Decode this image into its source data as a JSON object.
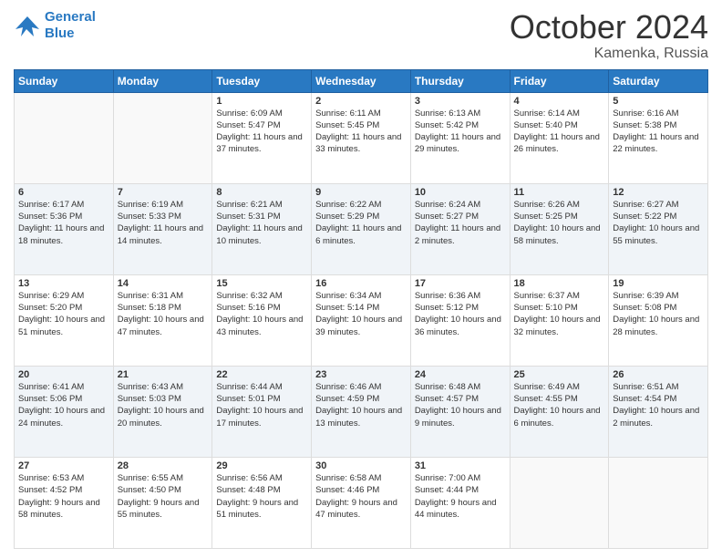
{
  "header": {
    "logo_line1": "General",
    "logo_line2": "Blue",
    "month": "October 2024",
    "location": "Kamenka, Russia"
  },
  "weekdays": [
    "Sunday",
    "Monday",
    "Tuesday",
    "Wednesday",
    "Thursday",
    "Friday",
    "Saturday"
  ],
  "weeks": [
    [
      {
        "day": "",
        "sunrise": "",
        "sunset": "",
        "daylight": ""
      },
      {
        "day": "",
        "sunrise": "",
        "sunset": "",
        "daylight": ""
      },
      {
        "day": "1",
        "sunrise": "Sunrise: 6:09 AM",
        "sunset": "Sunset: 5:47 PM",
        "daylight": "Daylight: 11 hours and 37 minutes."
      },
      {
        "day": "2",
        "sunrise": "Sunrise: 6:11 AM",
        "sunset": "Sunset: 5:45 PM",
        "daylight": "Daylight: 11 hours and 33 minutes."
      },
      {
        "day": "3",
        "sunrise": "Sunrise: 6:13 AM",
        "sunset": "Sunset: 5:42 PM",
        "daylight": "Daylight: 11 hours and 29 minutes."
      },
      {
        "day": "4",
        "sunrise": "Sunrise: 6:14 AM",
        "sunset": "Sunset: 5:40 PM",
        "daylight": "Daylight: 11 hours and 26 minutes."
      },
      {
        "day": "5",
        "sunrise": "Sunrise: 6:16 AM",
        "sunset": "Sunset: 5:38 PM",
        "daylight": "Daylight: 11 hours and 22 minutes."
      }
    ],
    [
      {
        "day": "6",
        "sunrise": "Sunrise: 6:17 AM",
        "sunset": "Sunset: 5:36 PM",
        "daylight": "Daylight: 11 hours and 18 minutes."
      },
      {
        "day": "7",
        "sunrise": "Sunrise: 6:19 AM",
        "sunset": "Sunset: 5:33 PM",
        "daylight": "Daylight: 11 hours and 14 minutes."
      },
      {
        "day": "8",
        "sunrise": "Sunrise: 6:21 AM",
        "sunset": "Sunset: 5:31 PM",
        "daylight": "Daylight: 11 hours and 10 minutes."
      },
      {
        "day": "9",
        "sunrise": "Sunrise: 6:22 AM",
        "sunset": "Sunset: 5:29 PM",
        "daylight": "Daylight: 11 hours and 6 minutes."
      },
      {
        "day": "10",
        "sunrise": "Sunrise: 6:24 AM",
        "sunset": "Sunset: 5:27 PM",
        "daylight": "Daylight: 11 hours and 2 minutes."
      },
      {
        "day": "11",
        "sunrise": "Sunrise: 6:26 AM",
        "sunset": "Sunset: 5:25 PM",
        "daylight": "Daylight: 10 hours and 58 minutes."
      },
      {
        "day": "12",
        "sunrise": "Sunrise: 6:27 AM",
        "sunset": "Sunset: 5:22 PM",
        "daylight": "Daylight: 10 hours and 55 minutes."
      }
    ],
    [
      {
        "day": "13",
        "sunrise": "Sunrise: 6:29 AM",
        "sunset": "Sunset: 5:20 PM",
        "daylight": "Daylight: 10 hours and 51 minutes."
      },
      {
        "day": "14",
        "sunrise": "Sunrise: 6:31 AM",
        "sunset": "Sunset: 5:18 PM",
        "daylight": "Daylight: 10 hours and 47 minutes."
      },
      {
        "day": "15",
        "sunrise": "Sunrise: 6:32 AM",
        "sunset": "Sunset: 5:16 PM",
        "daylight": "Daylight: 10 hours and 43 minutes."
      },
      {
        "day": "16",
        "sunrise": "Sunrise: 6:34 AM",
        "sunset": "Sunset: 5:14 PM",
        "daylight": "Daylight: 10 hours and 39 minutes."
      },
      {
        "day": "17",
        "sunrise": "Sunrise: 6:36 AM",
        "sunset": "Sunset: 5:12 PM",
        "daylight": "Daylight: 10 hours and 36 minutes."
      },
      {
        "day": "18",
        "sunrise": "Sunrise: 6:37 AM",
        "sunset": "Sunset: 5:10 PM",
        "daylight": "Daylight: 10 hours and 32 minutes."
      },
      {
        "day": "19",
        "sunrise": "Sunrise: 6:39 AM",
        "sunset": "Sunset: 5:08 PM",
        "daylight": "Daylight: 10 hours and 28 minutes."
      }
    ],
    [
      {
        "day": "20",
        "sunrise": "Sunrise: 6:41 AM",
        "sunset": "Sunset: 5:06 PM",
        "daylight": "Daylight: 10 hours and 24 minutes."
      },
      {
        "day": "21",
        "sunrise": "Sunrise: 6:43 AM",
        "sunset": "Sunset: 5:03 PM",
        "daylight": "Daylight: 10 hours and 20 minutes."
      },
      {
        "day": "22",
        "sunrise": "Sunrise: 6:44 AM",
        "sunset": "Sunset: 5:01 PM",
        "daylight": "Daylight: 10 hours and 17 minutes."
      },
      {
        "day": "23",
        "sunrise": "Sunrise: 6:46 AM",
        "sunset": "Sunset: 4:59 PM",
        "daylight": "Daylight: 10 hours and 13 minutes."
      },
      {
        "day": "24",
        "sunrise": "Sunrise: 6:48 AM",
        "sunset": "Sunset: 4:57 PM",
        "daylight": "Daylight: 10 hours and 9 minutes."
      },
      {
        "day": "25",
        "sunrise": "Sunrise: 6:49 AM",
        "sunset": "Sunset: 4:55 PM",
        "daylight": "Daylight: 10 hours and 6 minutes."
      },
      {
        "day": "26",
        "sunrise": "Sunrise: 6:51 AM",
        "sunset": "Sunset: 4:54 PM",
        "daylight": "Daylight: 10 hours and 2 minutes."
      }
    ],
    [
      {
        "day": "27",
        "sunrise": "Sunrise: 6:53 AM",
        "sunset": "Sunset: 4:52 PM",
        "daylight": "Daylight: 9 hours and 58 minutes."
      },
      {
        "day": "28",
        "sunrise": "Sunrise: 6:55 AM",
        "sunset": "Sunset: 4:50 PM",
        "daylight": "Daylight: 9 hours and 55 minutes."
      },
      {
        "day": "29",
        "sunrise": "Sunrise: 6:56 AM",
        "sunset": "Sunset: 4:48 PM",
        "daylight": "Daylight: 9 hours and 51 minutes."
      },
      {
        "day": "30",
        "sunrise": "Sunrise: 6:58 AM",
        "sunset": "Sunset: 4:46 PM",
        "daylight": "Daylight: 9 hours and 47 minutes."
      },
      {
        "day": "31",
        "sunrise": "Sunrise: 7:00 AM",
        "sunset": "Sunset: 4:44 PM",
        "daylight": "Daylight: 9 hours and 44 minutes."
      },
      {
        "day": "",
        "sunrise": "",
        "sunset": "",
        "daylight": ""
      },
      {
        "day": "",
        "sunrise": "",
        "sunset": "",
        "daylight": ""
      }
    ]
  ]
}
